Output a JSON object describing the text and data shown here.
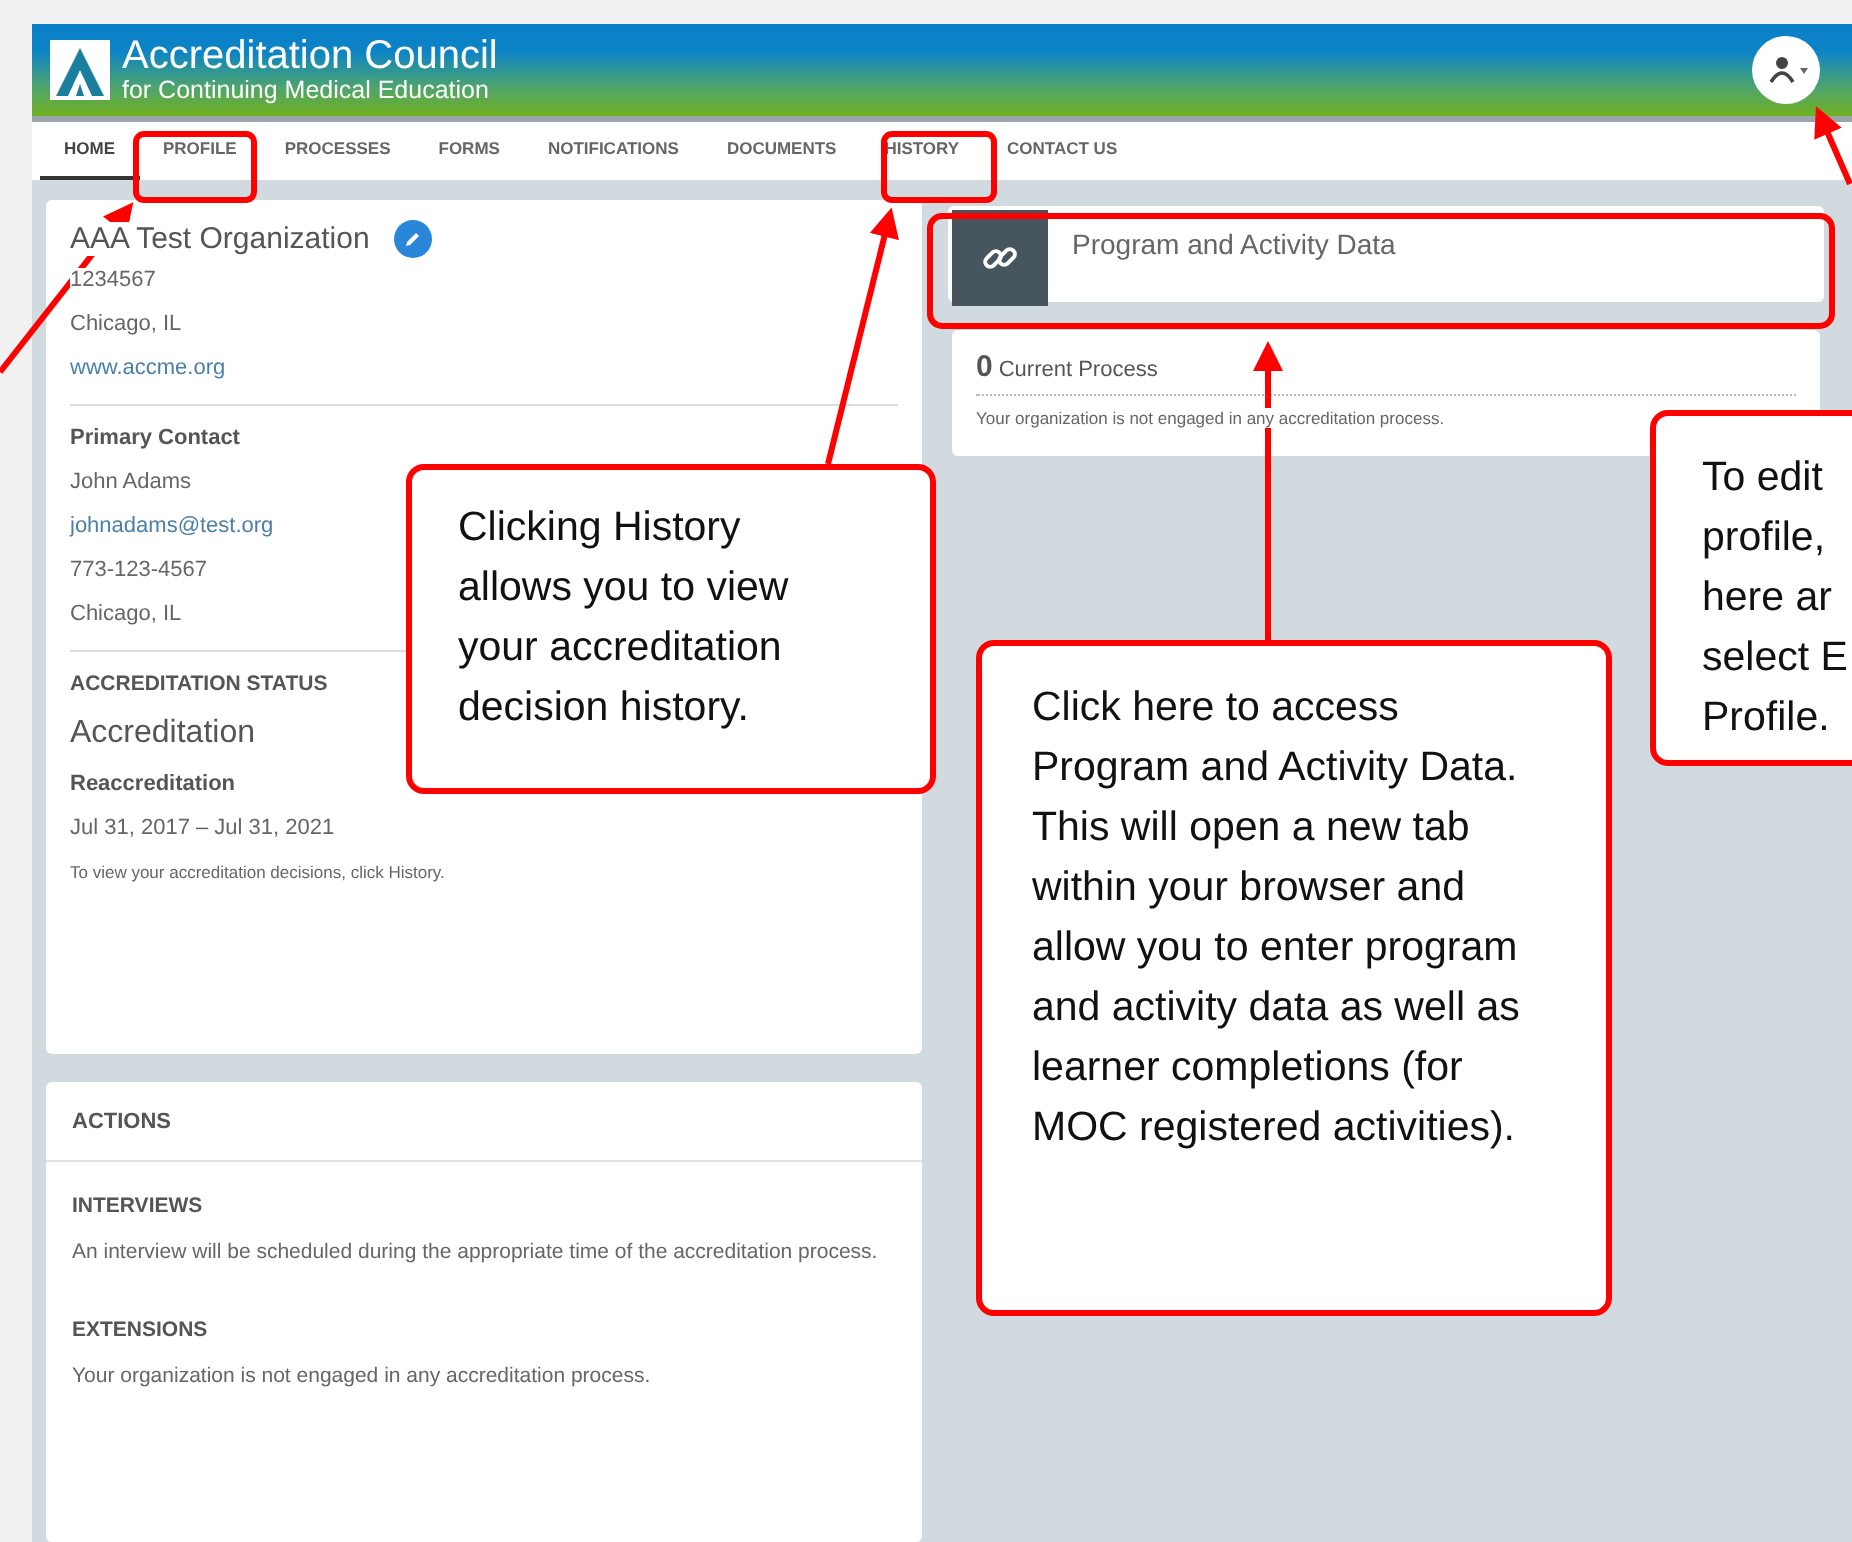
{
  "header": {
    "logo_title": "Accreditation Council",
    "logo_subtitle": "for Continuing Medical Education"
  },
  "nav": {
    "tabs": [
      {
        "label": "HOME",
        "selected": true
      },
      {
        "label": "PROFILE",
        "selected": false
      },
      {
        "label": "PROCESSES",
        "selected": false
      },
      {
        "label": "FORMS",
        "selected": false
      },
      {
        "label": "NOTIFICATIONS",
        "selected": false
      },
      {
        "label": "DOCUMENTS",
        "selected": false
      },
      {
        "label": "HISTORY",
        "selected": false
      },
      {
        "label": "CONTACT US",
        "selected": false
      }
    ]
  },
  "organization": {
    "name": "AAA Test Organization",
    "id": "1234567",
    "city": "Chicago, IL",
    "website": "www.accme.org",
    "contact_heading": "Primary Contact",
    "contact_name": "John Adams",
    "contact_email": "johnadams@test.org",
    "contact_phone": "773-123-4567",
    "contact_city": "Chicago, IL",
    "status_heading": "ACCREDITATION STATUS",
    "status": "Accreditation",
    "term_heading": "Reaccreditation",
    "term_dates": "Jul 31, 2017 – Jul 31, 2021",
    "note": "To view your accreditation decisions, click History."
  },
  "actions": {
    "title": "ACTIONS",
    "sections": [
      {
        "heading": "INTERVIEWS",
        "text": "An interview will be scheduled during the appropriate time of the accreditation process."
      },
      {
        "heading": "EXTENSIONS",
        "text": "Your organization is not engaged in any accreditation process."
      }
    ]
  },
  "program_card": {
    "title": "Program and Activity Data"
  },
  "current_process": {
    "count": "0",
    "label": "Current Process",
    "text": "Your organization is not engaged in any accreditation process."
  },
  "callouts": [
    {
      "text": "Clicking History allows you to view your accreditation decision history."
    },
    {
      "text": "Click here to access Program and Activity Data. This will open a new tab within your browser and allow you to enter program and activity data as well as learner completions (for MOC registered activities)."
    },
    {
      "lines": [
        "To edit",
        "profile,",
        "here ar",
        "select E",
        "Profile."
      ]
    }
  ]
}
